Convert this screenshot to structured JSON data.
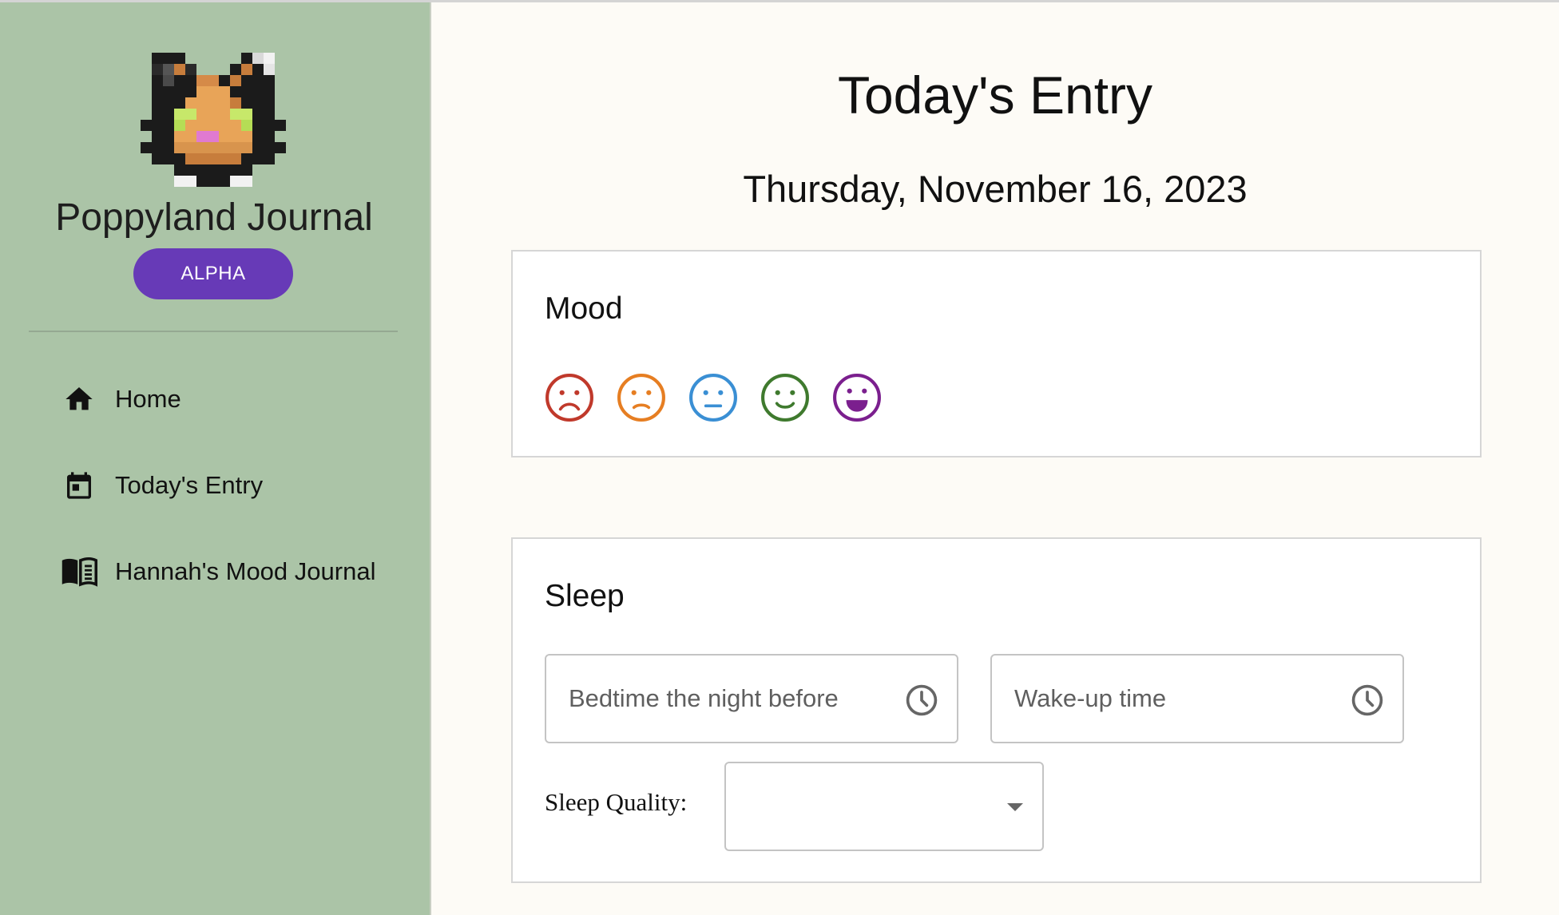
{
  "sidebar": {
    "app_title": "Poppyland Journal",
    "badge": "ALPHA",
    "nav": [
      {
        "label": "Home",
        "icon": "home-icon"
      },
      {
        "label": "Today's Entry",
        "icon": "calendar-icon"
      },
      {
        "label": "Hannah's Mood Journal",
        "icon": "book-icon"
      }
    ]
  },
  "main": {
    "title": "Today's Entry",
    "date": "Thursday, November 16, 2023",
    "mood": {
      "title": "Mood",
      "options": [
        {
          "icon": "very-sad-face-icon",
          "color": "#c0392b"
        },
        {
          "icon": "sad-face-icon",
          "color": "#e67e22"
        },
        {
          "icon": "neutral-face-icon",
          "color": "#3a8fd4"
        },
        {
          "icon": "happy-face-icon",
          "color": "#3f7a2e"
        },
        {
          "icon": "very-happy-face-icon",
          "color": "#7b1f8e"
        }
      ]
    },
    "sleep": {
      "title": "Sleep",
      "bedtime_placeholder": "Bedtime the night before",
      "wakeup_placeholder": "Wake-up time",
      "quality_label": "Sleep Quality:",
      "quality_value": ""
    }
  },
  "colors": {
    "sidebar_bg": "#abc4a7",
    "badge_bg": "#673ab7",
    "page_bg": "#fdfbf6"
  }
}
